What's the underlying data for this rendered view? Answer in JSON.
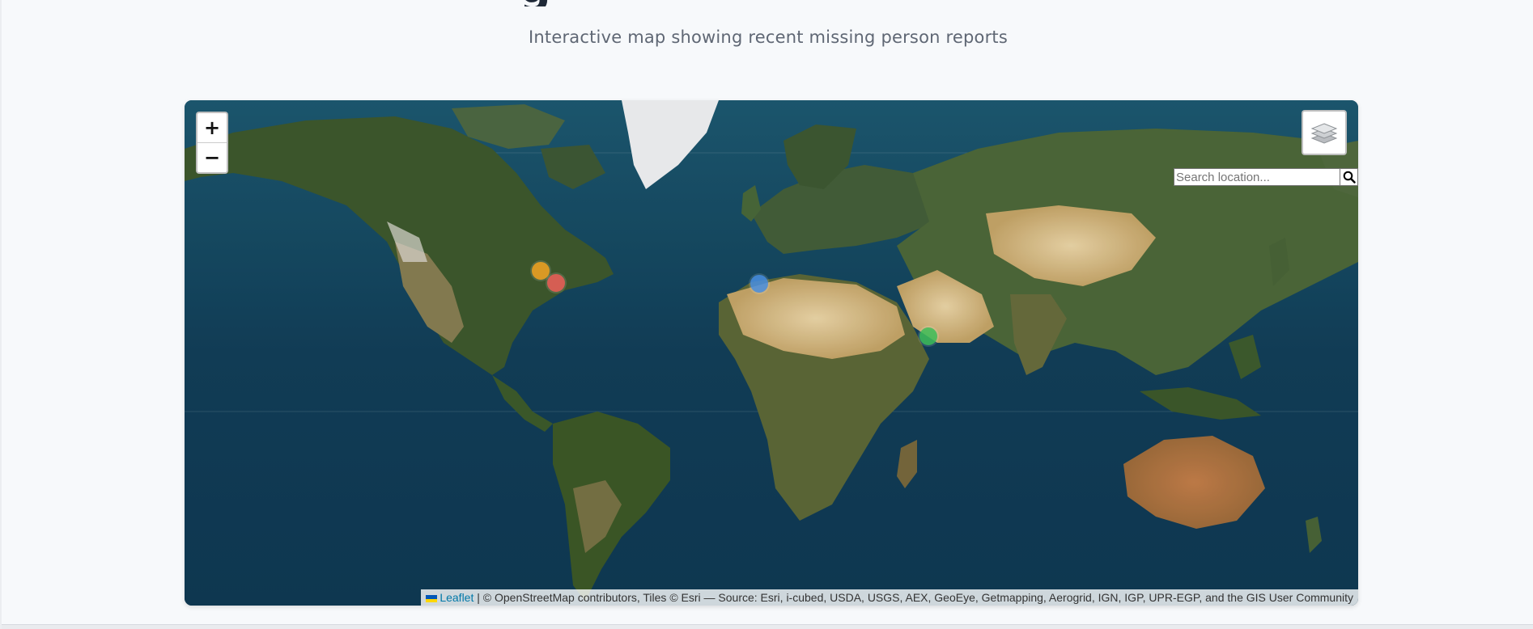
{
  "page": {
    "title_fragment": "g",
    "subtitle": "Interactive map showing recent missing person reports"
  },
  "map": {
    "zoom_in_label": "+",
    "zoom_out_label": "−",
    "layers_icon": "layers-icon",
    "search": {
      "placeholder": "Search location...",
      "value": "",
      "button_icon": "search-icon"
    },
    "markers": [
      {
        "id": "marker-orange",
        "color": "#f5a623"
      },
      {
        "id": "marker-red",
        "color": "#f0605b"
      },
      {
        "id": "marker-blue",
        "color": "#4a90e2"
      },
      {
        "id": "marker-green",
        "color": "#3fbf5b"
      }
    ],
    "attribution": {
      "leaflet_link": "Leaflet",
      "text": "| © OpenStreetMap contributors, Tiles © Esri — Source: Esri, i-cubed, USDA, USGS, AEX, GeoEye, Getmapping, Aerogrid, IGN, IGP, UPR-EGP, and the GIS User Community"
    }
  }
}
